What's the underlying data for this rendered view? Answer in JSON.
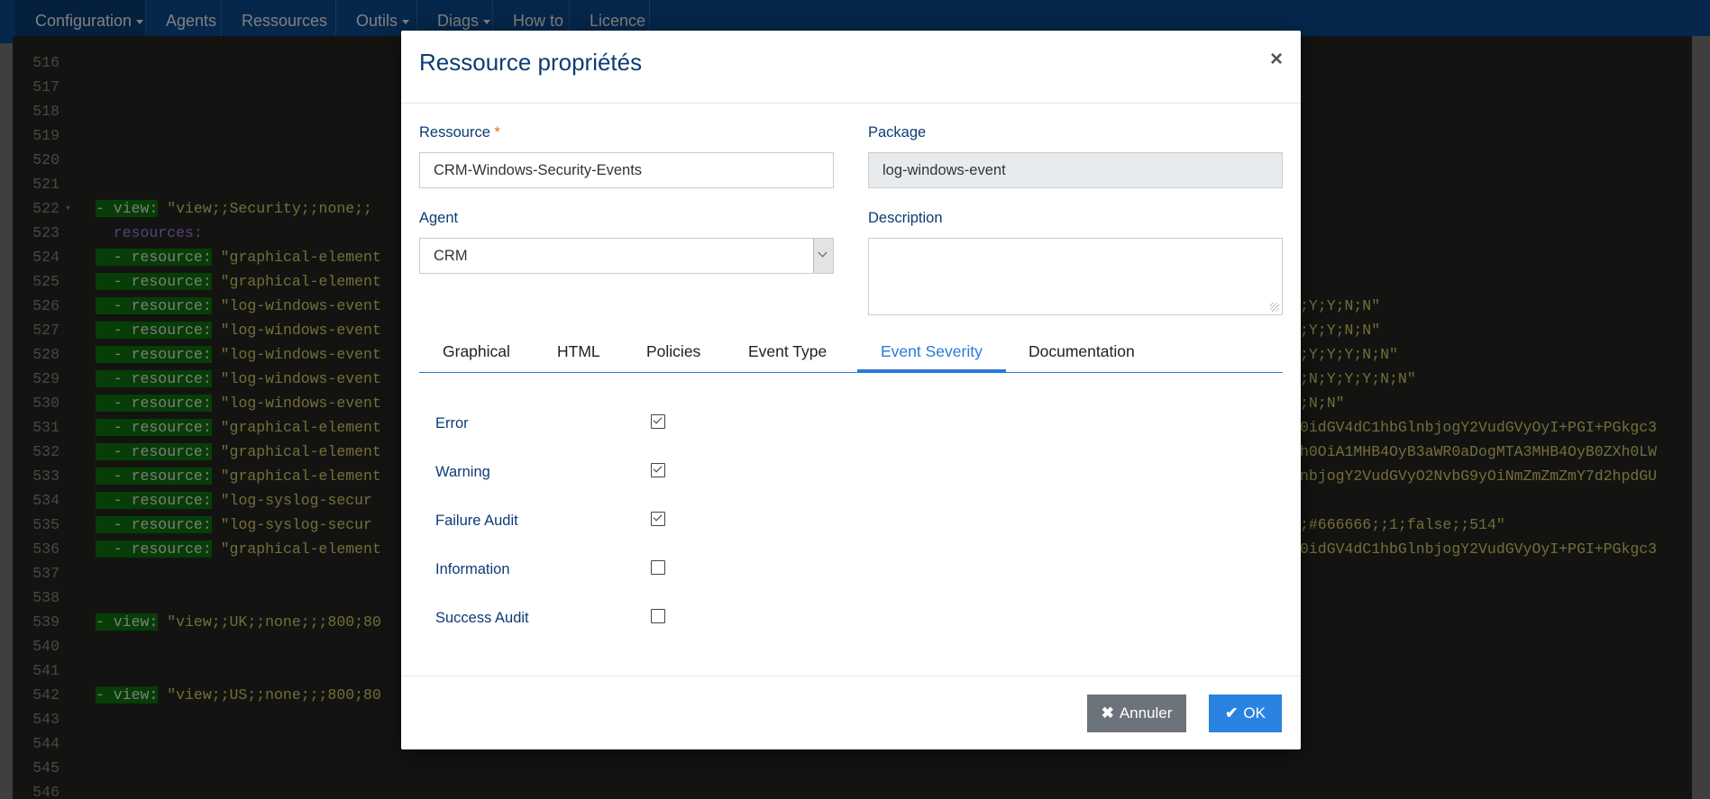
{
  "navbar": {
    "items": [
      {
        "label": "Configuration",
        "dropdown": true
      },
      {
        "label": "Agents",
        "dropdown": false
      },
      {
        "label": "Ressources",
        "dropdown": false
      },
      {
        "label": "Outils",
        "dropdown": true
      },
      {
        "label": "Diags",
        "dropdown": true
      },
      {
        "label": "How to",
        "dropdown": false
      },
      {
        "label": "Licence",
        "dropdown": false
      }
    ]
  },
  "editor": {
    "lines": [
      {
        "num": "516",
        "key": "",
        "value": "",
        "tail": ""
      },
      {
        "num": "517",
        "key": "",
        "value": "",
        "tail": ""
      },
      {
        "num": "518",
        "key": "",
        "value": "",
        "tail": ""
      },
      {
        "num": "519",
        "key": "",
        "value": "",
        "tail": ""
      },
      {
        "num": "520",
        "key": "",
        "value": "",
        "tail": ""
      },
      {
        "num": "521",
        "key": "",
        "value": "",
        "tail": ""
      },
      {
        "num": "522",
        "key": "- view:",
        "value": " \"view;;Security;;none;;",
        "tail": "",
        "fold": true
      },
      {
        "num": "523",
        "key": "",
        "value": "",
        "tail": "",
        "plain": "  resources:"
      },
      {
        "num": "524",
        "key": "  - resource:",
        "value": " \"graphical-element",
        "tail": ""
      },
      {
        "num": "525",
        "key": "  - resource:",
        "value": " \"graphical-element",
        "tail": ""
      },
      {
        "num": "526",
        "key": "  - resource:",
        "value": " \"log-windows-event",
        "tail": ";Y;Y;N;N\""
      },
      {
        "num": "527",
        "key": "  - resource:",
        "value": " \"log-windows-event",
        "tail": ";Y;Y;N;N\""
      },
      {
        "num": "528",
        "key": "  - resource:",
        "value": " \"log-windows-event",
        "tail": ";Y;Y;Y;N;N\""
      },
      {
        "num": "529",
        "key": "  - resource:",
        "value": " \"log-windows-event",
        "tail": ";N;Y;Y;Y;N;N\""
      },
      {
        "num": "530",
        "key": "  - resource:",
        "value": " \"log-windows-event",
        "tail": ";N;N\""
      },
      {
        "num": "531",
        "key": "  - resource:",
        "value": " \"graphical-element",
        "tail": "0idGV4dC1hbGlnbjogY2VudGVyOyI+PGI+PGkgc3"
      },
      {
        "num": "532",
        "key": "  - resource:",
        "value": " \"graphical-element",
        "tail": "h0OiA1MHB4OyB3aWR0aDogMTA3MHB4OyB0ZXh0LW"
      },
      {
        "num": "533",
        "key": "  - resource:",
        "value": " \"graphical-element",
        "tail": "nbjogY2VudGVyO2NvbG9yOiNmZmZmZmY7d2hpdGU"
      },
      {
        "num": "534",
        "key": "  - resource:",
        "value": " \"log-syslog-secur",
        "tail": ""
      },
      {
        "num": "535",
        "key": "  - resource:",
        "value": " \"log-syslog-secur",
        "tail": ";#666666;;1;false;;514\""
      },
      {
        "num": "536",
        "key": "  - resource:",
        "value": " \"graphical-element",
        "tail": "0idGV4dC1hbGlnbjogY2VudGVyOyI+PGI+PGkgc3"
      },
      {
        "num": "537",
        "key": "",
        "value": "",
        "tail": ""
      },
      {
        "num": "538",
        "key": "",
        "value": "",
        "tail": ""
      },
      {
        "num": "539",
        "key": "- view:",
        "value": " \"view;;UK;;none;;;800;80",
        "tail": ""
      },
      {
        "num": "540",
        "key": "",
        "value": "",
        "tail": ""
      },
      {
        "num": "541",
        "key": "",
        "value": "",
        "tail": ""
      },
      {
        "num": "542",
        "key": "- view:",
        "value": " \"view;;US;;none;;;800;80",
        "tail": ""
      },
      {
        "num": "543",
        "key": "",
        "value": "",
        "tail": ""
      },
      {
        "num": "544",
        "key": "",
        "value": "",
        "tail": ""
      },
      {
        "num": "545",
        "key": "",
        "value": "",
        "tail": ""
      },
      {
        "num": "546",
        "key": "",
        "value": "",
        "tail": ""
      }
    ]
  },
  "modal": {
    "title": "Ressource propriétés",
    "close": "×",
    "fields": {
      "ressource_label": "Ressource",
      "required_mark": "*",
      "ressource_value": "CRM-Windows-Security-Events",
      "package_label": "Package",
      "package_value": "log-windows-event",
      "agent_label": "Agent",
      "agent_value": "CRM",
      "description_label": "Description",
      "description_value": ""
    },
    "tabs": [
      {
        "label": "Graphical",
        "active": false
      },
      {
        "label": "HTML",
        "active": false
      },
      {
        "label": "Policies",
        "active": false
      },
      {
        "label": "Event Type",
        "active": false
      },
      {
        "label": "Event Severity",
        "active": true
      },
      {
        "label": "Documentation",
        "active": false
      }
    ],
    "severities": [
      {
        "label": "Error",
        "checked": true
      },
      {
        "label": "Warning",
        "checked": true
      },
      {
        "label": "Failure Audit",
        "checked": true
      },
      {
        "label": "Information",
        "checked": false
      },
      {
        "label": "Success Audit",
        "checked": false
      }
    ],
    "footer": {
      "cancel_label": "Annuler",
      "cancel_icon": "✖",
      "ok_label": "OK",
      "ok_icon": "✔"
    }
  }
}
